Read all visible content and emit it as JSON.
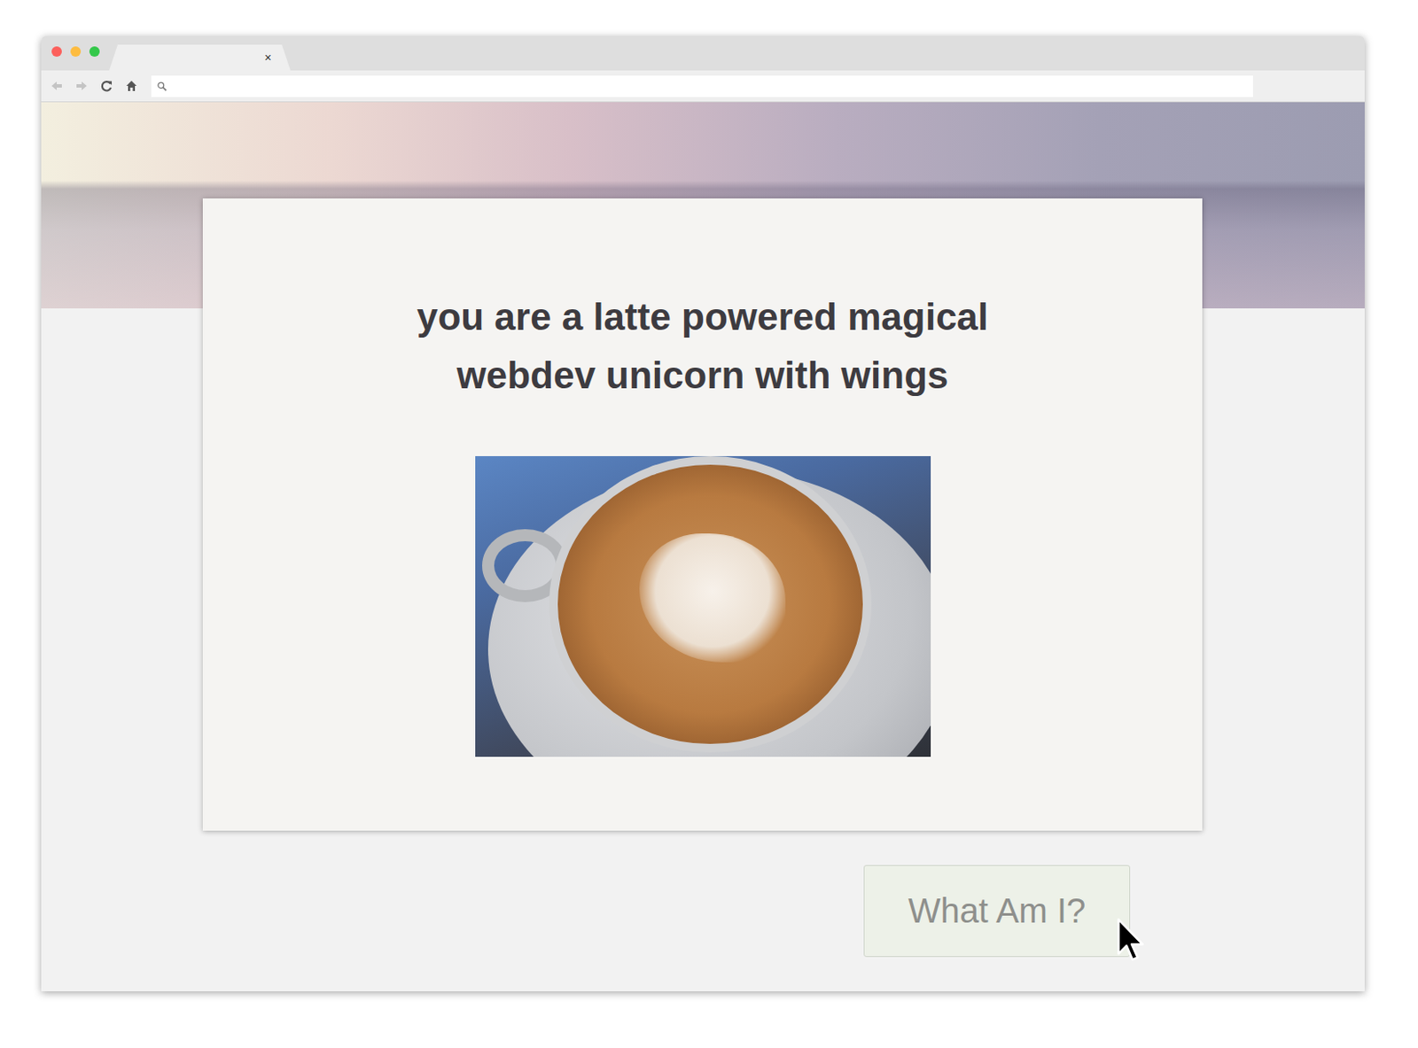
{
  "browser": {
    "tab": {
      "close": "×"
    }
  },
  "result": {
    "heading": "you are a latte powered magical webdev unicorn with wings"
  },
  "button": {
    "label": "What Am I?"
  }
}
